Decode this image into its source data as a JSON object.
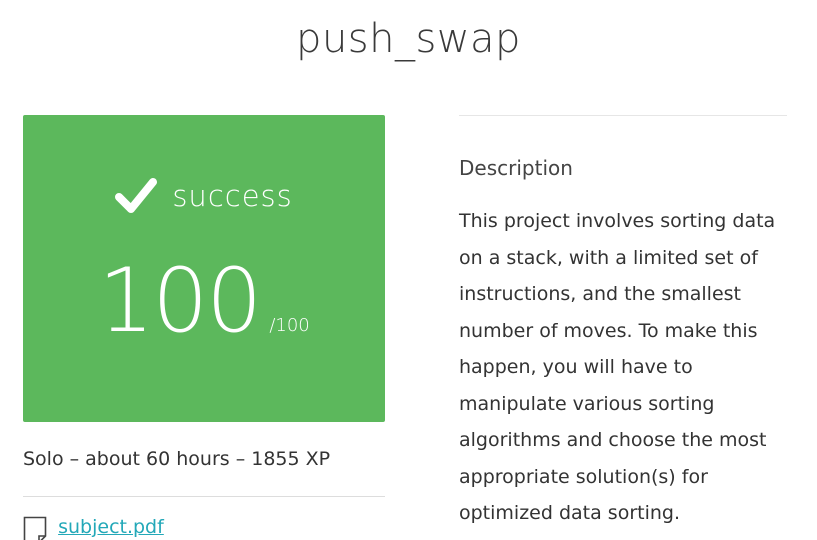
{
  "project": {
    "title": "push_swap"
  },
  "result": {
    "status_icon": "check-icon",
    "status_label": "success",
    "score": "100",
    "max_score": "/100",
    "card_color": "#5cb85c"
  },
  "meta": {
    "summary": "Solo – about 60 hours – 1855 XP"
  },
  "attachment": {
    "icon": "file-icon",
    "label": "subject.pdf",
    "link_color": "#23a8b8"
  },
  "description": {
    "heading": "Description",
    "body": "This project involves sorting data on a stack, with a limited set of instructions, and the smallest number of moves. To make this happen, you will have to manipulate various sorting algorithms and choose the most appropriate solution(s) for optimized data sorting."
  }
}
